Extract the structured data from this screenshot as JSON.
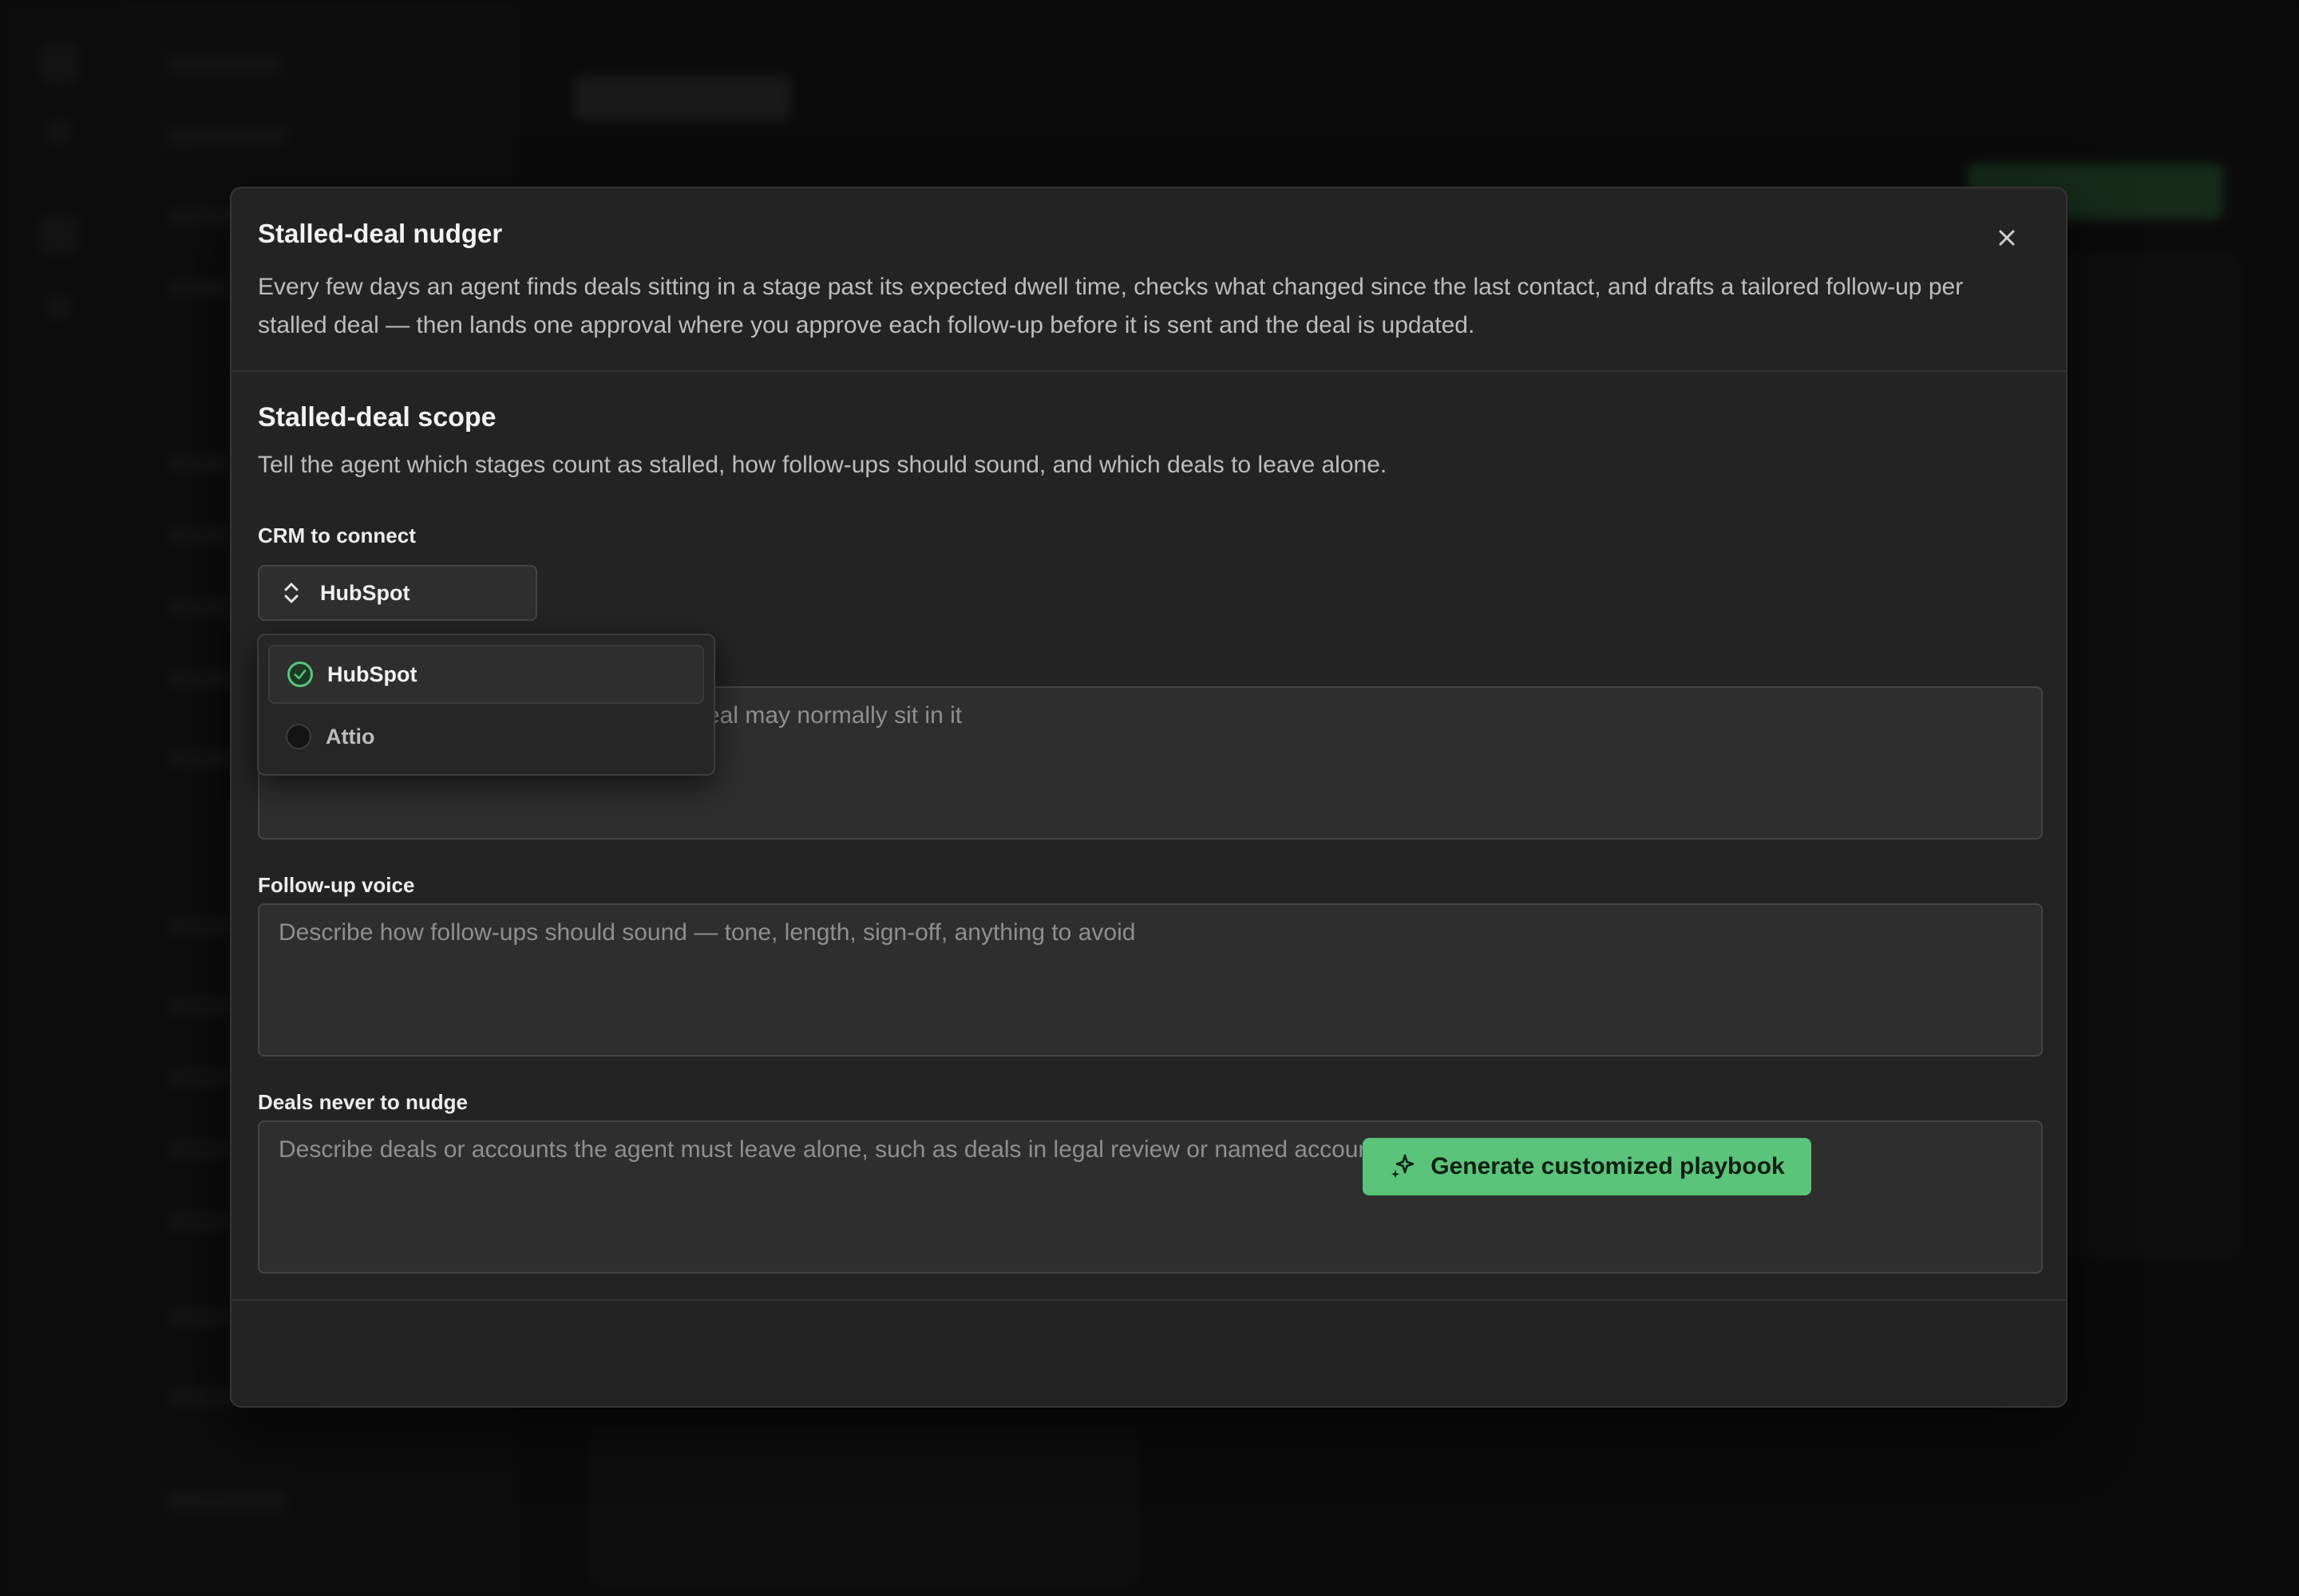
{
  "modal": {
    "title": "Stalled-deal nudger",
    "description": "Every few days an agent finds deals sitting in a stage past its expected dwell time, checks what changed since the last contact, and drafts a tailored follow-up per stalled deal — then lands one approval where you approve each follow-up before it is sent and the deal is updated.",
    "close_icon": "close-icon"
  },
  "section": {
    "title": "Stalled-deal scope",
    "description": "Tell the agent which stages count as stalled, how follow-ups should sound, and which deals to leave alone."
  },
  "crm": {
    "label": "CRM to connect",
    "selected": "HubSpot",
    "options": [
      {
        "label": "HubSpot",
        "checked": true
      },
      {
        "label": "Attio",
        "checked": false
      }
    ]
  },
  "fields": {
    "stages_placeholder_visible": "eal may normally sit in it",
    "voice_label": "Follow-up voice",
    "voice_placeholder": "Describe how follow-ups should sound — tone, length, sign-off, anything to avoid",
    "exclusions_label": "Deals never to nudge",
    "exclusions_placeholder": "Describe deals or accounts the agent must leave alone, such as deals in legal review or named accounts a founder owns"
  },
  "footer": {
    "generate_label": "Generate customized playbook",
    "generate_icon": "sparkles-icon"
  },
  "colors": {
    "accent": "#5ac47a",
    "modal_bg": "#232323",
    "page_bg": "#101010"
  }
}
